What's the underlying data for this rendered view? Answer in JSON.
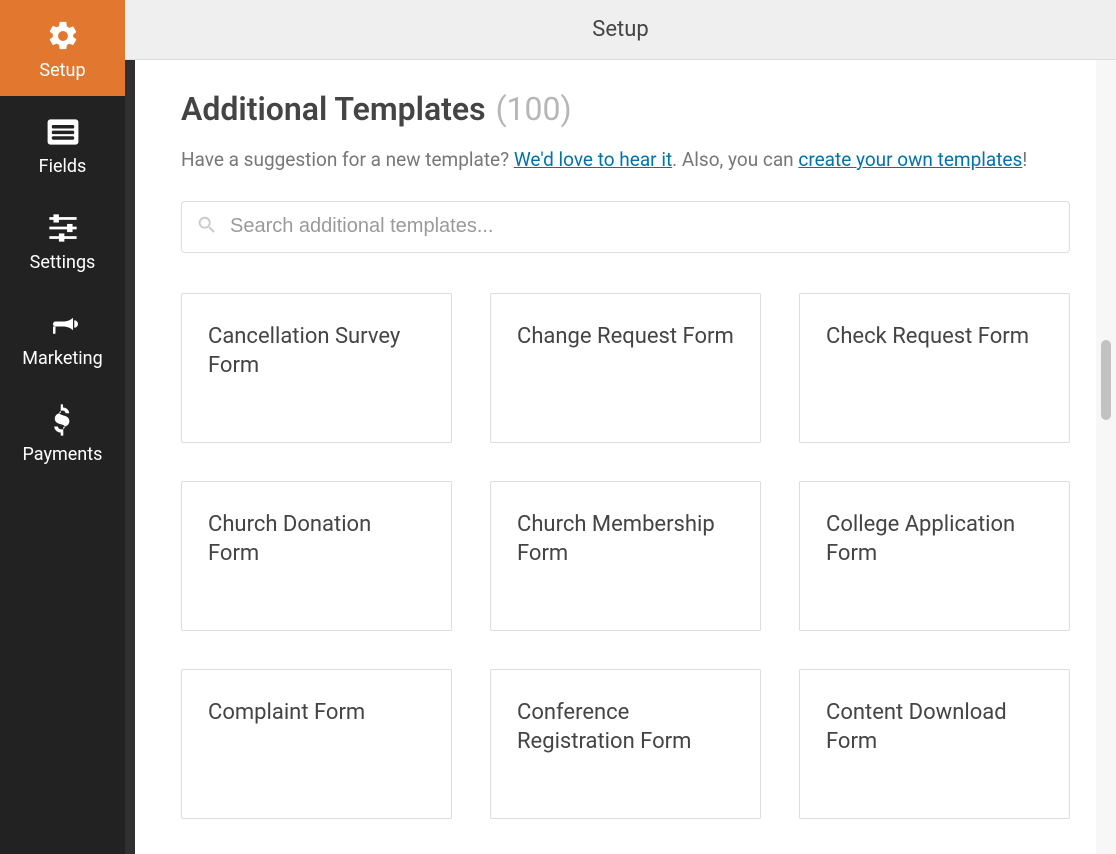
{
  "sidebar": {
    "items": [
      {
        "label": "Setup",
        "icon": "gear",
        "active": true
      },
      {
        "label": "Fields",
        "icon": "list",
        "active": false
      },
      {
        "label": "Settings",
        "icon": "sliders",
        "active": false
      },
      {
        "label": "Marketing",
        "icon": "bullhorn",
        "active": false
      },
      {
        "label": "Payments",
        "icon": "dollar",
        "active": false
      }
    ]
  },
  "topbar": {
    "title": "Setup"
  },
  "main": {
    "heading": "Additional Templates",
    "count": "(100)",
    "description_prefix": "Have a suggestion for a new template? ",
    "link_feedback": "We'd love to hear it",
    "description_mid": ". Also, you can ",
    "link_create": "create your own templates",
    "description_suffix": "!",
    "search_placeholder": "Search additional templates...",
    "templates": [
      {
        "title": "Cancellation Survey Form"
      },
      {
        "title": "Change Request Form"
      },
      {
        "title": "Check Request Form"
      },
      {
        "title": "Church Donation Form"
      },
      {
        "title": "Church Membership Form"
      },
      {
        "title": "College Application Form"
      },
      {
        "title": "Complaint Form"
      },
      {
        "title": "Conference Registration Form"
      },
      {
        "title": "Content Download Form"
      }
    ]
  }
}
